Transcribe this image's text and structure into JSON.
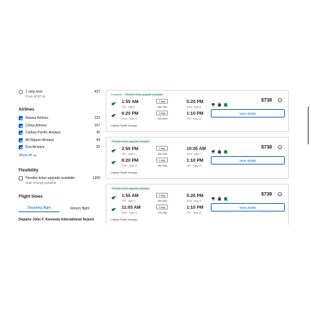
{
  "sidebar": {
    "stops": {
      "label": "1 stop max",
      "count": "437",
      "sub": "From $737.42"
    },
    "airlines_title": "Airlines",
    "airlines": [
      {
        "name": "Asiana Airlines",
        "count": "222"
      },
      {
        "name": "China Airlines",
        "count": "107"
      },
      {
        "name": "Cathay Pacific Airways",
        "count": "90"
      },
      {
        "name": "All Nippon Airways",
        "count": "84"
      },
      {
        "name": "Eva Airways",
        "count": "92"
      }
    ],
    "show_all": "Show all",
    "flex_title": "Flexibility",
    "flex": {
      "label": "Flexible ticket upgrade available",
      "count": "1200",
      "sub": "Date change possible"
    },
    "times_title": "Flight times",
    "tabs": [
      "Departing flight",
      "Return flight"
    ],
    "departs": "Departs John F. Kennedy International Airport"
  },
  "results": [
    {
      "badges": {
        "cheapest": "Cheapest",
        "flex": "Flexible ticket upgrade available"
      },
      "legs": [
        {
          "dep": "1:55 AM",
          "dep_sub": "JFK · May 5",
          "stops": "1 stop",
          "dur": "28h 25m",
          "arr": "5:20 PM",
          "arr_sub": "SGN · May 6"
        },
        {
          "dep": "6:20 PM",
          "dep_sub": "SGN · May 12",
          "stops": "1 stop",
          "dur": "29h 50m",
          "arr": "1:10 PM",
          "arr_sub": "JFK · May 13"
        }
      ],
      "airline": "Cathay Pacific Airways",
      "price": "$738",
      "button": "View details"
    },
    {
      "badges": {
        "cheapest": "",
        "flex": "Flexible ticket upgrade available"
      },
      "legs": [
        {
          "dep": "2:50 PM",
          "dep_sub": "JFK · May 5",
          "stops": "1 stop",
          "dur": "32h 15m",
          "arr": "10:05 AM",
          "arr_sub": "SGN · May 7"
        },
        {
          "dep": "6:20 PM",
          "dep_sub": "SGN · May 12",
          "stops": "1 stop",
          "dur": "29h 50m",
          "arr": "1:10 PM",
          "arr_sub": "JFK · May 13"
        }
      ],
      "airline": "Cathay Pacific Airways",
      "price": "$738",
      "button": "View details"
    },
    {
      "badges": {
        "cheapest": "",
        "flex": "Flexible ticket upgrade available"
      },
      "legs": [
        {
          "dep": "1:55 AM",
          "dep_sub": "JFK · May 5",
          "stops": "1 stop",
          "dur": "28h 25m",
          "arr": "5:20 PM",
          "arr_sub": "SGN · May 6"
        },
        {
          "dep": "11:05 AM",
          "dep_sub": "SGN · May 12",
          "stops": "1 stop",
          "dur": "37h 05m",
          "arr": "1:10 PM",
          "arr_sub": "JFK · May 13"
        }
      ],
      "airline": "Cathay Pacific Airways",
      "price": "$738",
      "button": "View details"
    }
  ],
  "colors": {
    "accent": "#0262c7",
    "badge_green": "#0f7b2e"
  },
  "icons": [
    "chevron-down-icon",
    "cathay-logo-icon",
    "seat-icon",
    "cabin-bag-icon",
    "checked-bag-icon",
    "info-icon"
  ]
}
